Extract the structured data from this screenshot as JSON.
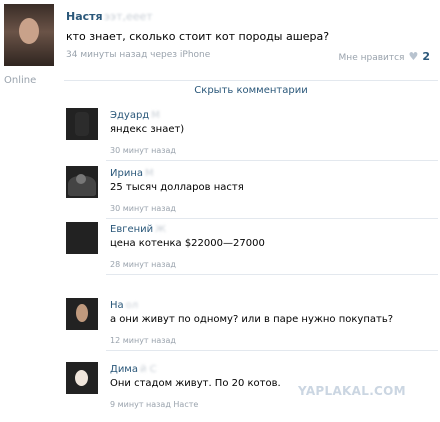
{
  "post": {
    "author": "Настя",
    "author_tail": "ээт,ееет",
    "text": "кто знает, сколько стоит кот породы ашера?",
    "meta": "34 минуты назад через iPhone",
    "likes_label": "Мне нравится",
    "likes_count": "2",
    "online": "Online"
  },
  "hide_comments": "Скрыть комментарии",
  "comments": [
    {
      "name": "Эдуард",
      "name_blur": "М",
      "text": "яндекс знает)",
      "time": "30 минут назад"
    },
    {
      "name": "Ирина",
      "name_blur": "М",
      "text": "25 тысяч долларов настя",
      "time": "30 минут назад"
    },
    {
      "name": "Евгений",
      "name_blur": "Ж",
      "text": "цена котенка $22000—27000",
      "time": "28 минут назад"
    },
    {
      "name": "На",
      "name_blur": "ол",
      "text": "а они живут по одному? или в паре нужно покупать?",
      "time": "12 минут назад"
    },
    {
      "name": "Дима",
      "name_blur": "й С",
      "text": "Они стадом живут. По 20 котов.",
      "time": "9 минут назад Насте"
    }
  ],
  "watermark": "YAPLAKAL.COM"
}
